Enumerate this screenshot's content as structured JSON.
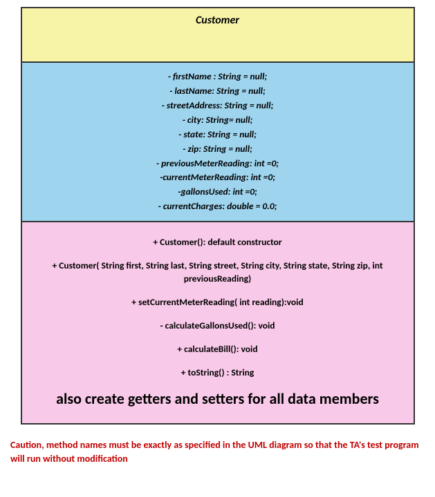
{
  "class_name": "Customer",
  "attributes": [
    "- firstName : String = null;",
    "- lastName: String = null;",
    "- streetAddress:  String = null;",
    "- city:  String= null;",
    "- state:  String = null;",
    "- zip:  String = null;",
    "- previousMeterReading: int =0;",
    "-currentMeterReading: int =0;",
    "-gallonsUsed: int =0;",
    "- currentCharges: double = 0.0;"
  ],
  "methods": [
    "+ Customer():  default constructor",
    "+ Customer( String first, String last, String street, String city, String state, String zip, int previousReading)",
    "+ setCurrentMeterReading( int reading):void",
    "- calculateGallonsUsed(): void",
    "+ calculateBill(): void",
    "+ toString() : String"
  ],
  "method_note": "also create getters and setters for all data members",
  "caution_text": "Caution, method names must be exactly as specified in the UML diagram so that the TA's test program will run without modification"
}
